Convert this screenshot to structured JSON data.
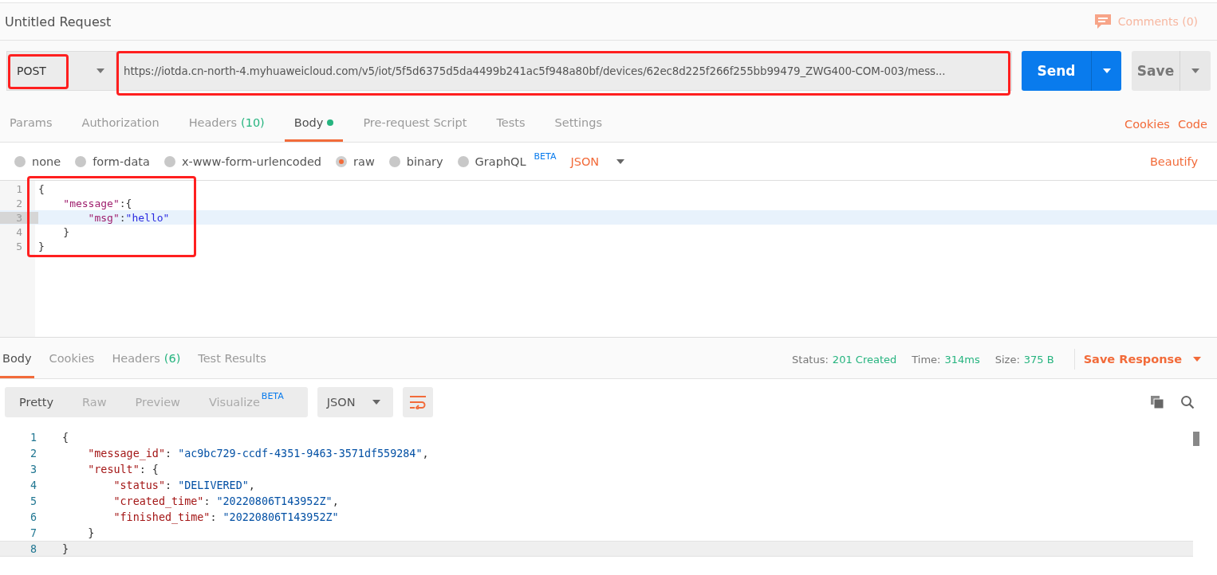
{
  "request": {
    "title": "Untitled Request",
    "comments": "Comments (0)",
    "method": {
      "label": "POST",
      "highlighted": true
    },
    "url": {
      "value": "https://iotda.cn-north-4.myhuaweicloud.com/v5/iot/5f5d6375d5da4499b241ac5f948a80bf/devices/62ec8d225f266f255bb99479_ZWG400-COM-003/mess...",
      "highlighted": true
    },
    "send": "Send",
    "save": "Save"
  },
  "request_tabs": [
    {
      "label": "Params",
      "selected": false
    },
    {
      "label": "Authorization",
      "selected": false
    },
    {
      "label": "Headers",
      "count": "(10)",
      "selected": false
    },
    {
      "label": "Body",
      "dot": true,
      "selected": true
    },
    {
      "label": "Pre-request Script",
      "selected": false
    },
    {
      "label": "Tests",
      "selected": false
    },
    {
      "label": "Settings",
      "selected": false
    }
  ],
  "request_links": [
    "Cookies",
    "Code"
  ],
  "body_types": [
    {
      "label": "none",
      "selected": false
    },
    {
      "label": "form-data",
      "selected": false
    },
    {
      "label": "x-www-form-urlencoded",
      "selected": false
    },
    {
      "label": "raw",
      "selected": true
    },
    {
      "label": "binary",
      "selected": false
    },
    {
      "label": "GraphQL",
      "badge": "BETA",
      "selected": false
    }
  ],
  "body_format": "JSON",
  "beautify": "Beautify",
  "body_editor": {
    "highlighted": true,
    "lines": [
      {
        "number": "1",
        "selected": false,
        "tokens": [
          {
            "kind": "punct",
            "text": "{"
          }
        ]
      },
      {
        "number": "2",
        "selected": false,
        "tokens": [
          {
            "kind": "key",
            "text": "    \"message\""
          },
          {
            "kind": "punct",
            "text": ":{"
          }
        ]
      },
      {
        "number": "3",
        "selected": true,
        "tokens": [
          {
            "kind": "key",
            "text": "        \"msg\""
          },
          {
            "kind": "punct",
            "text": ":"
          },
          {
            "kind": "str",
            "text": "\"hello\""
          }
        ]
      },
      {
        "number": "4",
        "selected": false,
        "tokens": [
          {
            "kind": "punct",
            "text": "    }"
          }
        ]
      },
      {
        "number": "5",
        "selected": false,
        "tokens": [
          {
            "kind": "punct",
            "text": "}"
          }
        ]
      }
    ]
  },
  "response_tabs": [
    {
      "label": "Body",
      "selected": true
    },
    {
      "label": "Cookies",
      "selected": false
    },
    {
      "label": "Headers",
      "count": "(6)",
      "selected": false
    },
    {
      "label": "Test Results",
      "selected": false
    }
  ],
  "response_meta": [
    {
      "label": "Status:",
      "value": "201 Created"
    },
    {
      "label": "Time:",
      "value": "314ms"
    },
    {
      "label": "Size:",
      "value": "375 B"
    }
  ],
  "save_response": "Save Response",
  "view_modes": [
    {
      "label": "Pretty",
      "selected": true
    },
    {
      "label": "Raw",
      "selected": false
    },
    {
      "label": "Preview",
      "selected": false
    },
    {
      "label": "Visualize",
      "badge": "BETA",
      "selected": false
    }
  ],
  "response_format": "JSON",
  "response_body": {
    "lines": [
      {
        "number": "1",
        "selected": false,
        "tokens": [
          {
            "kind": "punct",
            "text": "{"
          }
        ]
      },
      {
        "number": "2",
        "selected": false,
        "tokens": [
          {
            "kind": "key",
            "text": "    \"message_id\""
          },
          {
            "kind": "punct",
            "text": ": "
          },
          {
            "kind": "str",
            "text": "\"ac9bc729-ccdf-4351-9463-3571df559284\""
          },
          {
            "kind": "punct",
            "text": ","
          }
        ]
      },
      {
        "number": "3",
        "selected": false,
        "tokens": [
          {
            "kind": "key",
            "text": "    \"result\""
          },
          {
            "kind": "punct",
            "text": ": {"
          }
        ]
      },
      {
        "number": "4",
        "selected": false,
        "tokens": [
          {
            "kind": "key",
            "text": "        \"status\""
          },
          {
            "kind": "punct",
            "text": ": "
          },
          {
            "kind": "str",
            "text": "\"DELIVERED\""
          },
          {
            "kind": "punct",
            "text": ","
          }
        ]
      },
      {
        "number": "5",
        "selected": false,
        "tokens": [
          {
            "kind": "key",
            "text": "        \"created_time\""
          },
          {
            "kind": "punct",
            "text": ": "
          },
          {
            "kind": "str",
            "text": "\"20220806T143952Z\""
          },
          {
            "kind": "punct",
            "text": ","
          }
        ]
      },
      {
        "number": "6",
        "selected": false,
        "tokens": [
          {
            "kind": "key",
            "text": "        \"finished_time\""
          },
          {
            "kind": "punct",
            "text": ": "
          },
          {
            "kind": "str",
            "text": "\"20220806T143952Z\""
          }
        ]
      },
      {
        "number": "7",
        "selected": false,
        "tokens": [
          {
            "kind": "punct",
            "text": "    }"
          }
        ]
      },
      {
        "number": "8",
        "selected": true,
        "tokens": [
          {
            "kind": "punct",
            "text": "}"
          }
        ]
      }
    ]
  }
}
